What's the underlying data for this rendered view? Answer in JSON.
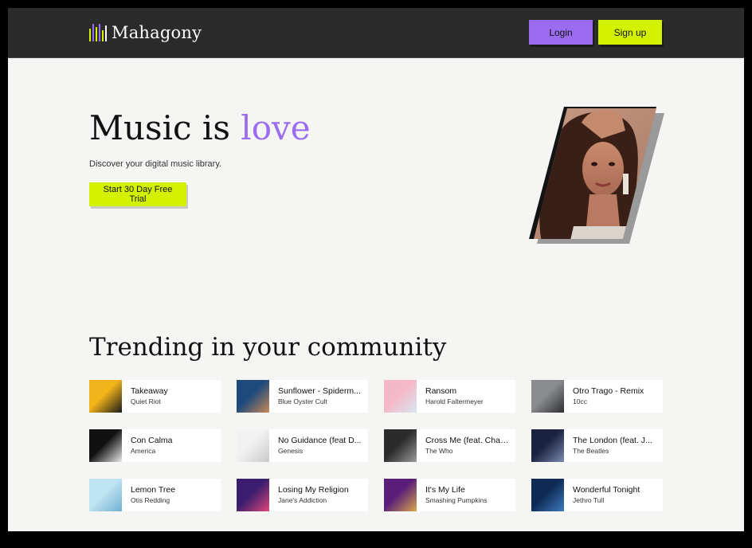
{
  "colors": {
    "accent_purple": "#9b6cf0",
    "accent_lime": "#d4f200",
    "header_bg": "#2b2b2b",
    "page_bg": "#f5f5f3"
  },
  "header": {
    "brand": "Mahagony",
    "logo_icon": "equalizer-bars-icon",
    "login_label": "Login",
    "signup_label": "Sign up"
  },
  "hero": {
    "title_main": "Music is ",
    "title_accent": "love",
    "subtitle": "Discover your digital music library.",
    "cta_label": "Start 30 Day Free Trial",
    "image_icon": "artist-portrait-image"
  },
  "trending": {
    "title": "Trending in your community",
    "tracks": [
      {
        "title": "Takeaway",
        "artist": "Quiet Riot",
        "cover": [
          "#f2b21a",
          "#1a1a1a"
        ]
      },
      {
        "title": "Sunflower - Spiderm...",
        "artist": "Blue Oyster Cult",
        "cover": [
          "#1d4a7a",
          "#c98a5a"
        ]
      },
      {
        "title": "Ransom",
        "artist": "Harold Faltermeyer",
        "cover": [
          "#f4b8c8",
          "#d8e6ef"
        ]
      },
      {
        "title": "Otro Trago - Remix",
        "artist": "10cc",
        "cover": [
          "#8a8c90",
          "#2e3034"
        ]
      },
      {
        "title": "Con Calma",
        "artist": "America",
        "cover": [
          "#111111",
          "#e8e8e8"
        ]
      },
      {
        "title": "No Guidance (feat D...",
        "artist": "Genesis",
        "cover": [
          "#f1f1f1",
          "#c9c9c9"
        ]
      },
      {
        "title": "Cross Me (feat. Chan...",
        "artist": "The Who",
        "cover": [
          "#2b2b2b",
          "#9a9a9a"
        ]
      },
      {
        "title": "The London (feat. J...",
        "artist": "The Beatles",
        "cover": [
          "#1a2340",
          "#7a8ab0"
        ]
      },
      {
        "title": "Lemon Tree",
        "artist": "Otis Redding",
        "cover": [
          "#bfe4f2",
          "#6fb0d0"
        ]
      },
      {
        "title": "Losing My Religion",
        "artist": "Jane's Addiction",
        "cover": [
          "#3a1d6e",
          "#e0467a"
        ]
      },
      {
        "title": "It's My Life",
        "artist": "Smashing Pumpkins",
        "cover": [
          "#5a1e7a",
          "#d9a84a"
        ]
      },
      {
        "title": "Wonderful Tonight",
        "artist": "Jethro Tull",
        "cover": [
          "#0e2a55",
          "#3f7cc0"
        ]
      }
    ]
  }
}
